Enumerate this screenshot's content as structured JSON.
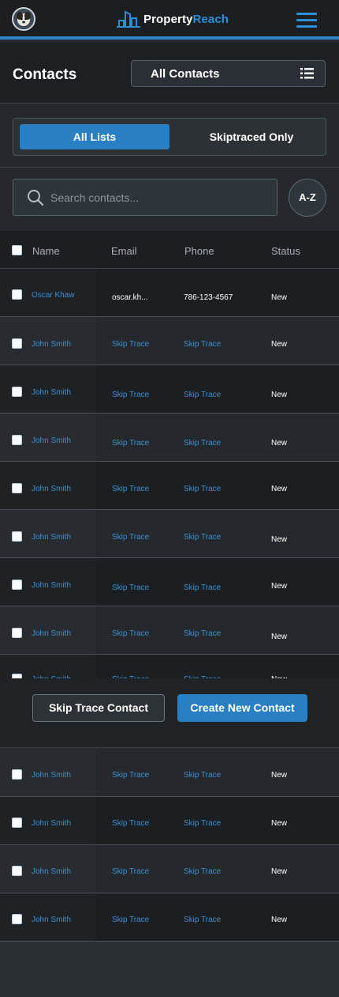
{
  "header": {
    "brand_part1": "Property",
    "brand_part2": "Reach",
    "accent_color": "#2b84c8"
  },
  "page": {
    "title": "Contacts",
    "list_select_value": "All Contacts"
  },
  "toggle": {
    "active_label": "All Lists",
    "inactive_label": "Skiptraced Only"
  },
  "search": {
    "placeholder": "Search contacts...",
    "sort_label": "A-Z"
  },
  "table": {
    "columns": [
      "Name",
      "Email",
      "Phone",
      "Status"
    ],
    "rows": [
      {
        "name": "Oscar Khaw",
        "email": "oscar.kh...",
        "phone": "786-123-4567",
        "status": "New"
      },
      {
        "name": "John Smith",
        "email": "Skip Trace",
        "phone": "Skip Trace",
        "status": "New"
      },
      {
        "name": "John Smith",
        "email": "Skip Trace",
        "phone": "Skip Trace",
        "status": "New"
      },
      {
        "name": "John Smith",
        "email": "Skip Trace",
        "phone": "Skip Trace",
        "status": "New"
      },
      {
        "name": "John Smith",
        "email": "Skip Trace",
        "phone": "Skip Trace",
        "status": "New"
      },
      {
        "name": "John Smith",
        "email": "Skip Trace",
        "phone": "Skip Trace",
        "status": "New"
      },
      {
        "name": "John Smith",
        "email": "Skip Trace",
        "phone": "Skip Trace",
        "status": "New"
      },
      {
        "name": "John Smith",
        "email": "Skip Trace",
        "phone": "Skip Trace",
        "status": "New"
      },
      {
        "name": "John Smith",
        "email": "Skip Trace",
        "phone": "Skip Trace",
        "status": "New"
      },
      {
        "name": "John Smith",
        "email": "Skip Trace",
        "phone": "Skip Trace",
        "status": "New"
      },
      {
        "name": "John Smith",
        "email": "Skip Trace",
        "phone": "Skip Trace",
        "status": "New"
      },
      {
        "name": "John Smith",
        "email": "Skip Trace",
        "phone": "Skip Trace",
        "status": "New"
      },
      {
        "name": "John Smith",
        "email": "Skip Trace",
        "phone": "Skip Trace",
        "status": "New"
      }
    ]
  },
  "actions": {
    "secondary_label": "Skip Trace Contact",
    "primary_label": "Create New Contact"
  }
}
